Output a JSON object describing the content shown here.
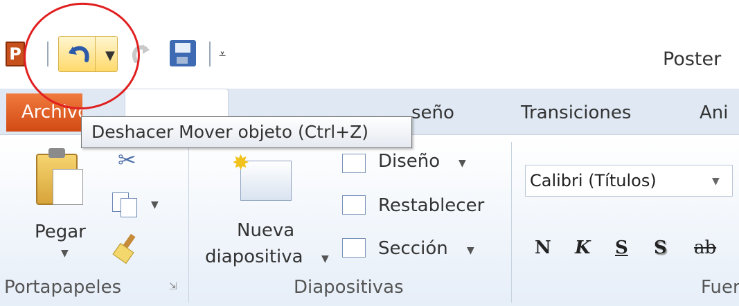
{
  "title_bar": {
    "title": "Poster"
  },
  "quick_access": {
    "app_logo": "P",
    "undo_icon": "undo-arrow-icon",
    "redo_icon": "redo-arrow-icon",
    "save_icon": "floppy-disk-icon",
    "customize_glyph": "⩡"
  },
  "tabs": {
    "file": "Archivo",
    "design_partial": "seño",
    "transitions": "Transiciones",
    "animations_partial": "Ani"
  },
  "tooltip": {
    "text": "Deshacer Mover objeto (Ctrl+Z)"
  },
  "ribbon": {
    "clipboard": {
      "paste_label": "Pegar",
      "group_label": "Portapapeles",
      "launcher_glyph": "⇲"
    },
    "slides": {
      "new_slide_line1": "Nueva",
      "new_slide_line2": "diapositiva",
      "layout_label": "Diseño",
      "reset_label": "Restablecer",
      "section_label": "Sección",
      "group_label": "Diapositivas"
    },
    "font": {
      "font_name": "Calibri (Títulos)",
      "bold": "N",
      "italic": "K",
      "underline": "S",
      "shadow": "S",
      "strike_partial": "ab",
      "group_label_partial": "Fuer"
    }
  },
  "colors": {
    "file_tab": "#d24a14",
    "annotation": "#e02020",
    "undo_highlight": "#ffd96b"
  }
}
